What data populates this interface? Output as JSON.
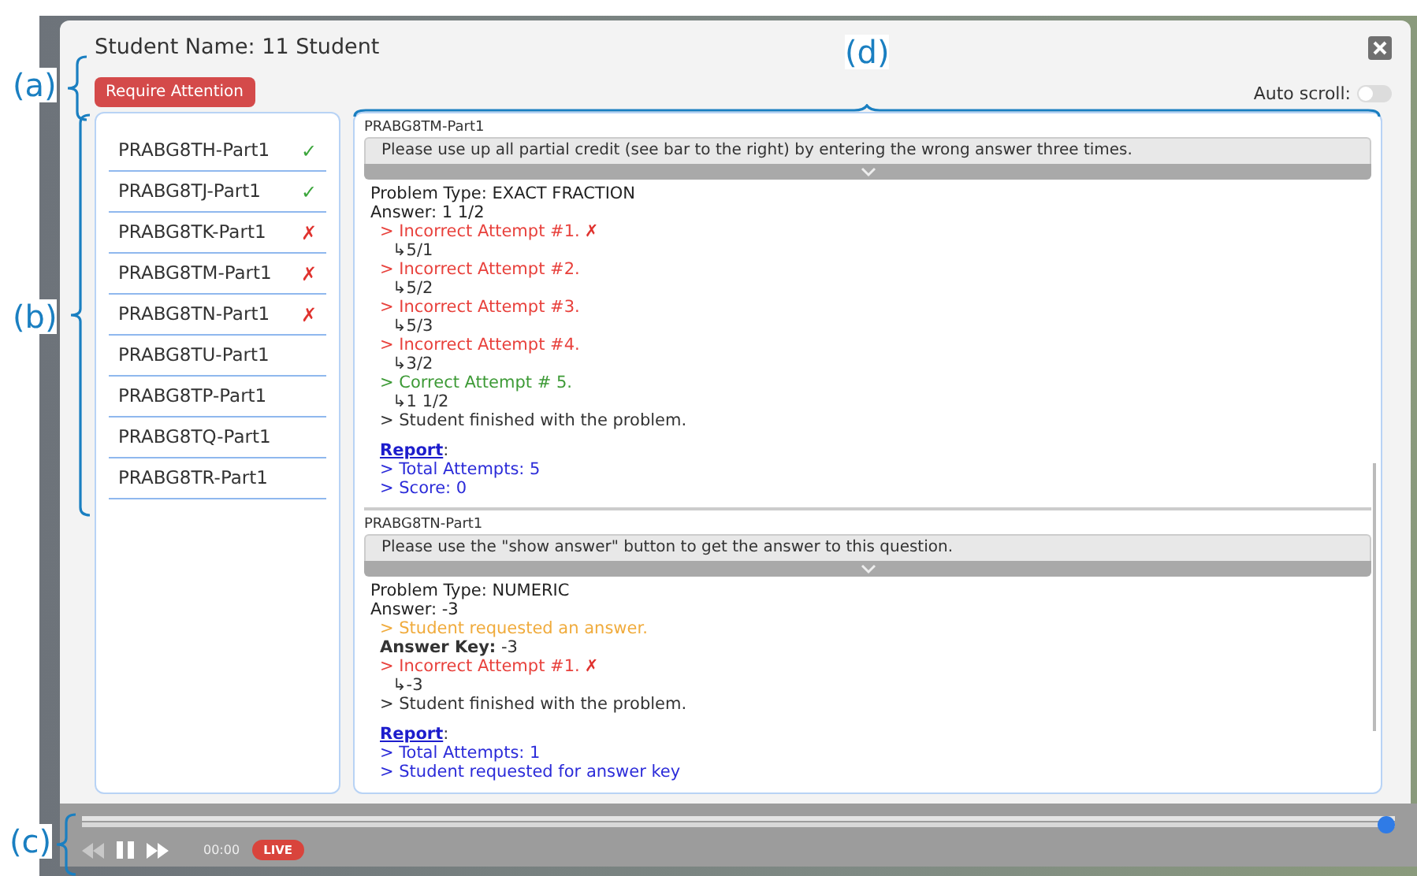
{
  "annotations": [
    {
      "label": "(a)",
      "kind": "left"
    },
    {
      "label": "(b)",
      "kind": "left"
    },
    {
      "label": "(c)",
      "kind": "left"
    },
    {
      "label": "(d)",
      "kind": "top"
    }
  ],
  "title": "Student Name: 11 Student",
  "require_attention_button": "Require Attention",
  "auto_scroll": {
    "label": "Auto scroll:",
    "on": false
  },
  "problems": [
    {
      "label": "PRABG8TH-Part1",
      "passed": true,
      "mark": "✓"
    },
    {
      "label": "PRABG8TJ-Part1",
      "passed": true,
      "mark": "✓"
    },
    {
      "label": "PRABG8TK-Part1",
      "passed": false,
      "mark": "✗"
    },
    {
      "label": "PRABG8TM-Part1",
      "passed": false,
      "mark": "✗"
    },
    {
      "label": "PRABG8TN-Part1",
      "passed": false,
      "mark": "✗"
    },
    {
      "label": "PRABG8TU-Part1"
    },
    {
      "label": "PRABG8TP-Part1"
    },
    {
      "label": "PRABG8TQ-Part1"
    },
    {
      "label": "PRABG8TR-Part1"
    }
  ],
  "log": [
    {
      "title": "PRABG8TM-Part1",
      "hint": "Please use up all partial credit (see bar to the right) by entering the wrong answer three times.",
      "problem_type": "Problem Type: EXACT FRACTION",
      "answer": "Answer: 1 1/2",
      "events": [
        {
          "kind": "incorrect",
          "text": "> Incorrect Attempt #1.",
          "mark": "✗"
        },
        {
          "kind": "response",
          "text": "↳5/1"
        },
        {
          "kind": "incorrect",
          "text": "> Incorrect Attempt #2."
        },
        {
          "kind": "response",
          "text": "↳5/2"
        },
        {
          "kind": "incorrect",
          "text": "> Incorrect Attempt #3."
        },
        {
          "kind": "response",
          "text": "↳5/3"
        },
        {
          "kind": "incorrect",
          "text": "> Incorrect Attempt #4."
        },
        {
          "kind": "response",
          "text": "↳3/2"
        },
        {
          "kind": "correct",
          "text": "> Correct Attempt # 5."
        },
        {
          "kind": "response",
          "text": "↳1 1/2"
        },
        {
          "kind": "info",
          "text": "> Student finished with the problem."
        }
      ],
      "report_link": "Report",
      "report_suffix": ":",
      "report": [
        "> Total Attempts: 5",
        "> Score: 0"
      ]
    },
    {
      "title": "PRABG8TN-Part1",
      "hint": "Please use the \"show answer\" button to get the answer to this question.",
      "problem_type": "Problem Type: NUMERIC",
      "answer": "Answer: -3",
      "events": [
        {
          "kind": "request",
          "text": "> Student requested an answer."
        },
        {
          "kind": "key",
          "text": "**Answer Key:** -3"
        },
        {
          "kind": "incorrect",
          "text": "> Incorrect Attempt #1.",
          "mark": "✗"
        },
        {
          "kind": "response",
          "text": "↳-3"
        },
        {
          "kind": "info",
          "text": "> Student finished with the problem."
        }
      ],
      "report_link": "Report",
      "report_suffix": ":",
      "report": [
        "> Total Attempts: 1",
        "> Student requested for answer key"
      ]
    }
  ],
  "player": {
    "level": 1.0,
    "time": "00:00",
    "live_badge": "LIVE"
  }
}
